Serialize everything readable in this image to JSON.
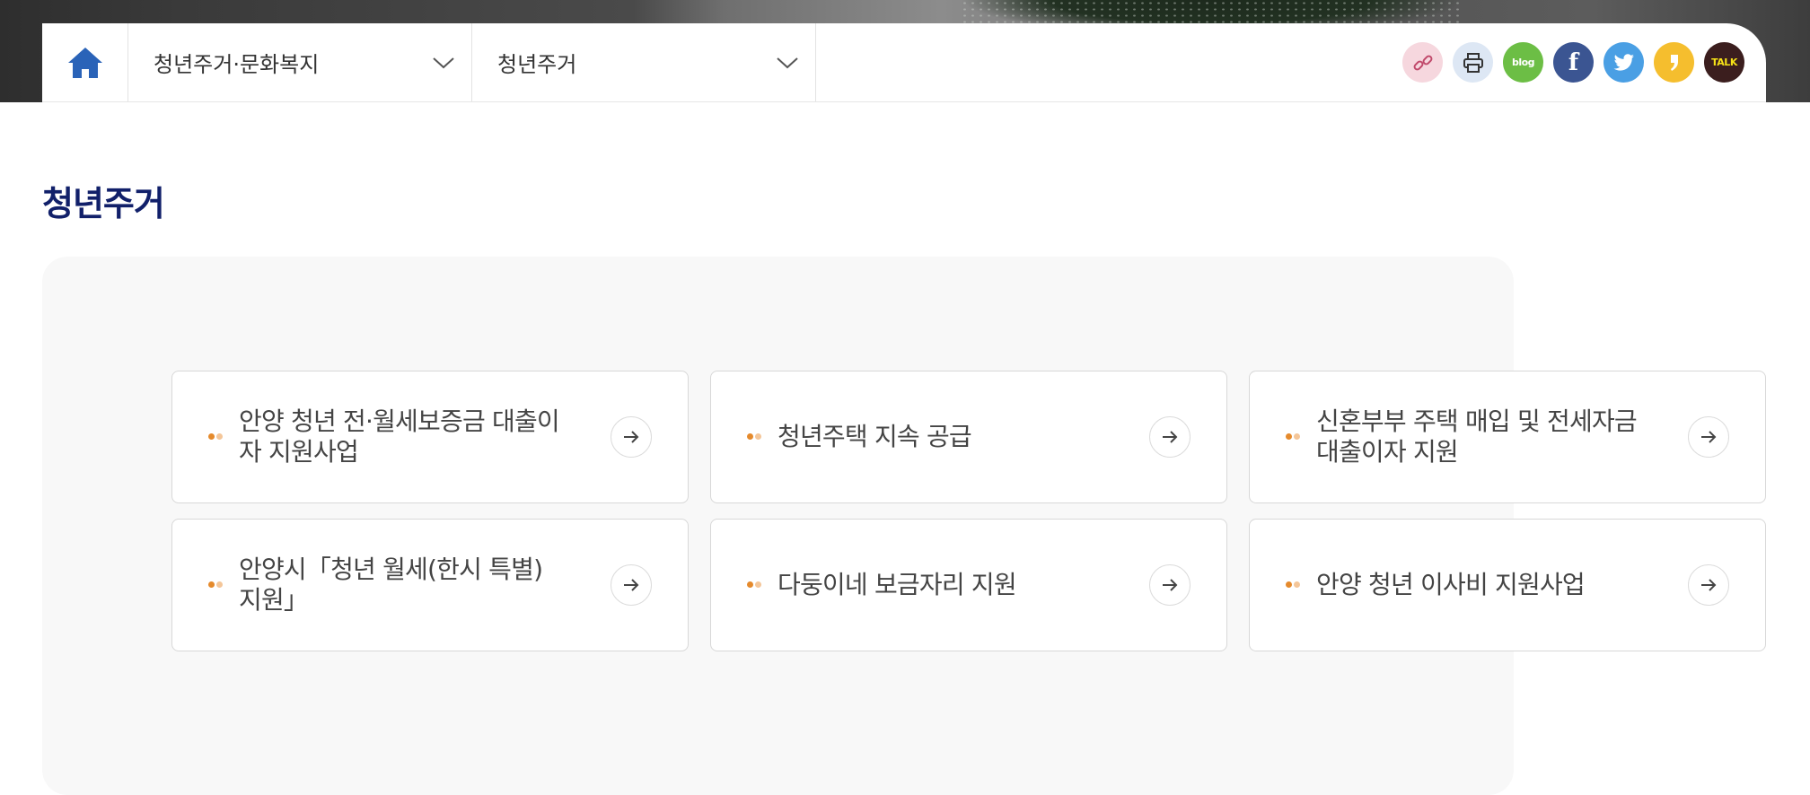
{
  "nav": {
    "home_icon": "home-icon",
    "depth1": "청년주거·문화복지",
    "depth2": "청년주거"
  },
  "share": [
    {
      "name": "link",
      "icon": "link-icon"
    },
    {
      "name": "print",
      "icon": "print-icon"
    },
    {
      "name": "blog",
      "label": "blog"
    },
    {
      "name": "facebook",
      "label": "f"
    },
    {
      "name": "twitter",
      "icon": "twitter-icon"
    },
    {
      "name": "kakaostory",
      "icon": "kakaostory-icon"
    },
    {
      "name": "kakaotalk",
      "label": "TALK"
    }
  ],
  "page": {
    "title": "청년주거"
  },
  "cards": [
    {
      "label": "안양 청년 전·월세보증금 대출이자 지원사업"
    },
    {
      "label": "청년주택 지속 공급"
    },
    {
      "label": "신혼부부 주택 매입 및 전세자금 대출이자 지원"
    },
    {
      "label": "안양시「청년 월세(한시 특별) 지원」"
    },
    {
      "label": "다둥이네 보금자리 지원"
    },
    {
      "label": "안양 청년 이사비 지원사업"
    }
  ],
  "colors": {
    "title": "#11206a",
    "home_icon": "#2a63b8",
    "dot_primary": "#e58a2c",
    "dot_secondary": "#f4c699"
  }
}
